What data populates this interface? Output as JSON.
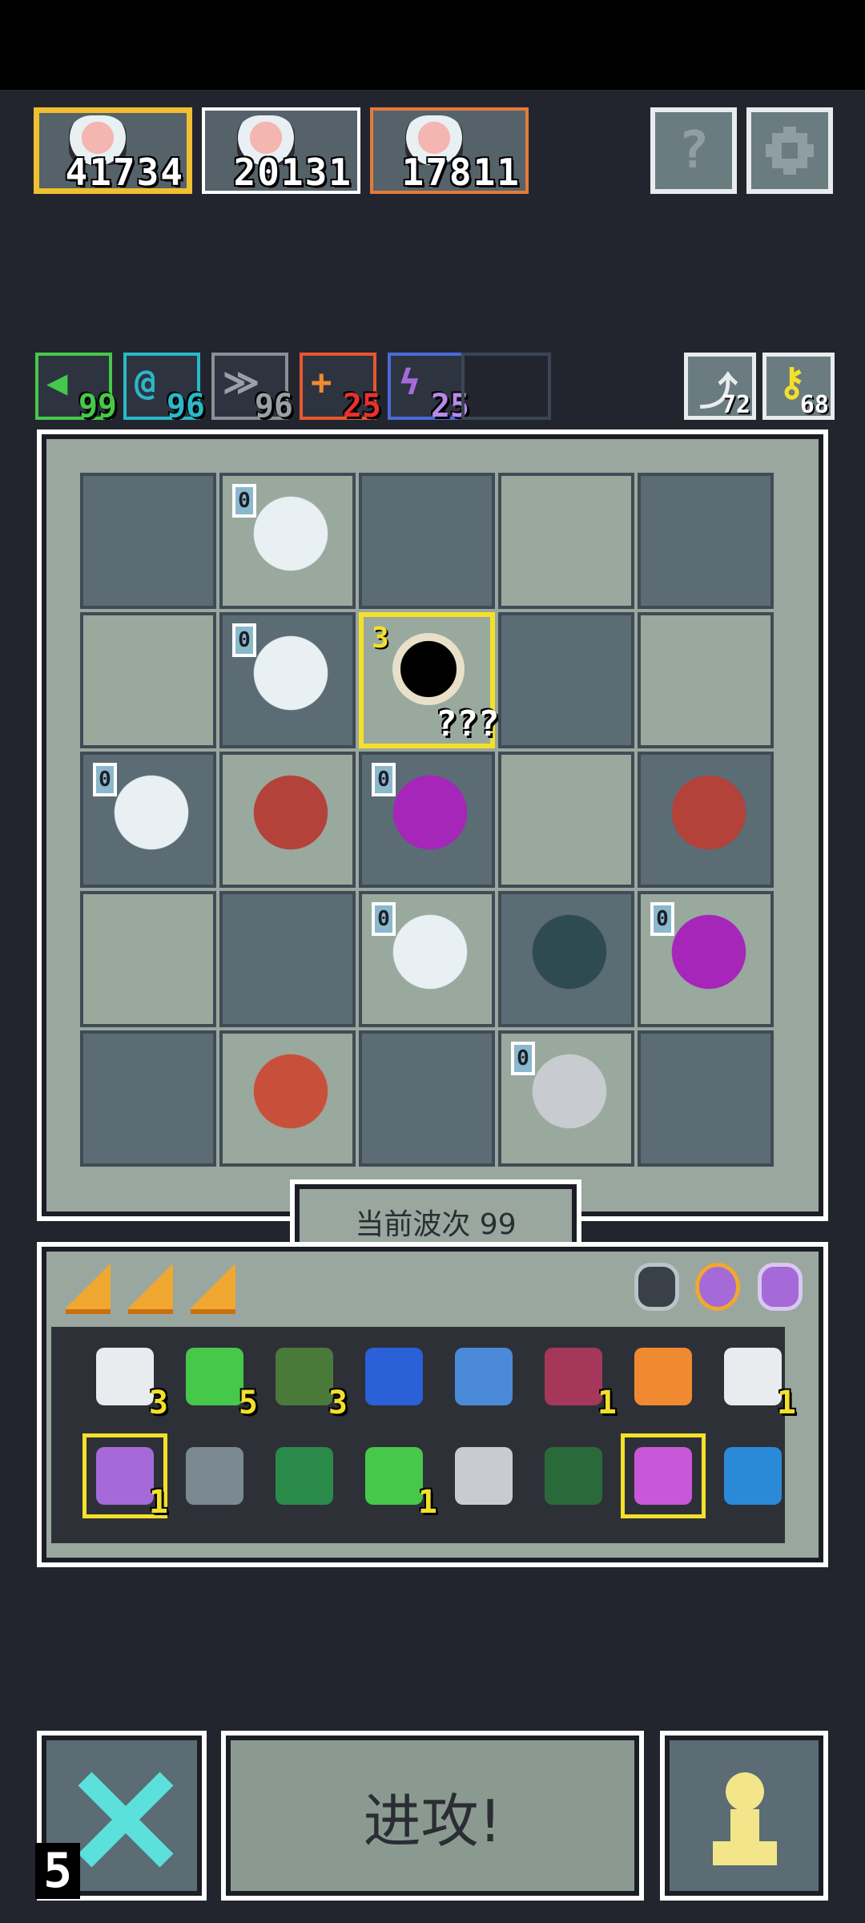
{
  "heroes": [
    {
      "score": "41734"
    },
    {
      "score": "20131"
    },
    {
      "score": "17811"
    }
  ],
  "buttons": {
    "help": "?",
    "settings": "gear-icon",
    "attack": "进攻!",
    "reroll_count": "5"
  },
  "resources": [
    {
      "icon": "green-arrow-icon",
      "value": "99",
      "color": "#46c84a"
    },
    {
      "icon": "cyan-swirl-icon",
      "value": "96",
      "color": "#2ab8c8"
    },
    {
      "icon": "gray-wing-icon",
      "value": "96",
      "color": "#9aa0a6"
    },
    {
      "icon": "orange-plus-icon",
      "value": "25",
      "color": "#e8572f"
    },
    {
      "icon": "purple-lightning-icon",
      "value": "25",
      "color": "#a56ad8"
    }
  ],
  "counters": [
    {
      "icon": "undo-arrow-icon",
      "value": "72"
    },
    {
      "icon": "key-icon",
      "value": "68"
    }
  ],
  "board": {
    "wave_label": "当前波次 99",
    "special_tag": "???",
    "special_level": "3",
    "unit_level": "0"
  },
  "inventory": {
    "items_row1": [
      {
        "icon": "scroll-icon",
        "count": "3"
      },
      {
        "icon": "green-gem-icon",
        "count": "5"
      },
      {
        "icon": "goblin-helmet-icon",
        "count": "3"
      },
      {
        "icon": "water-tome-icon",
        "count": ""
      },
      {
        "icon": "blue-claw-icon",
        "count": ""
      },
      {
        "icon": "demon-shield-icon",
        "count": "1"
      },
      {
        "icon": "orange-horn-icon",
        "count": ""
      },
      {
        "icon": "white-feather-icon",
        "count": "1"
      }
    ],
    "items_row2": [
      {
        "icon": "potion-jar-icon",
        "count": "1"
      },
      {
        "icon": "anvil-icon",
        "count": ""
      },
      {
        "icon": "green-arrow-wand-icon",
        "count": ""
      },
      {
        "icon": "vine-icon",
        "count": "1"
      },
      {
        "icon": "dagger-icon",
        "count": ""
      },
      {
        "icon": "rune-book-icon",
        "count": ""
      },
      {
        "icon": "purple-key-icon",
        "count": ""
      },
      {
        "icon": "blue-drop-icon",
        "count": ""
      }
    ]
  }
}
